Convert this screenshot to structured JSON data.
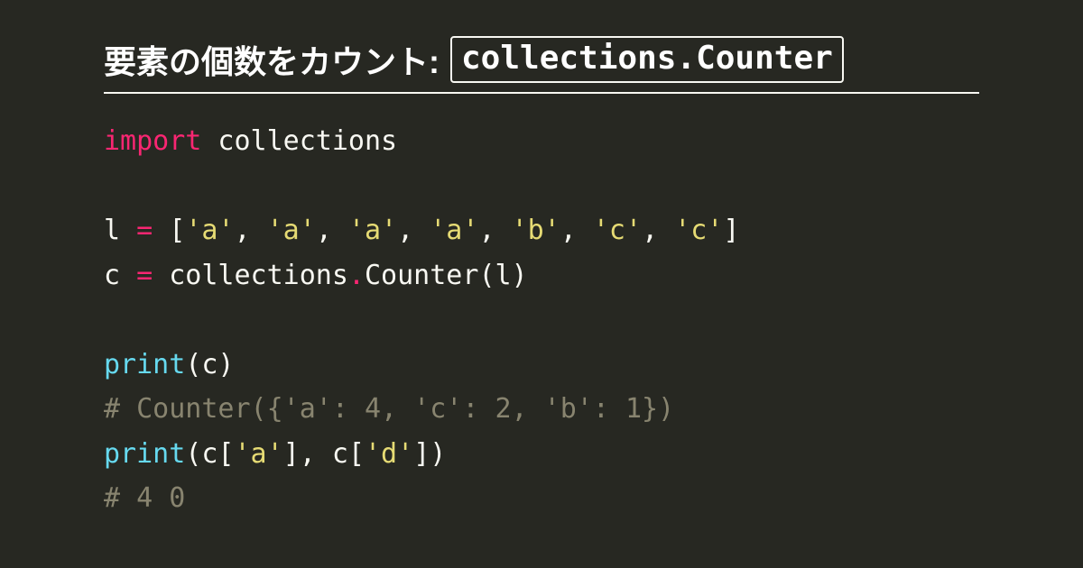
{
  "header": {
    "title_text": "要素の個数をカウント:",
    "title_code": "collections.Counter"
  },
  "code": {
    "lines": [
      [
        {
          "cls": "tok-kw",
          "t": "import"
        },
        {
          "cls": "tok-def",
          "t": " collections"
        }
      ],
      [],
      [
        {
          "cls": "tok-def",
          "t": "l "
        },
        {
          "cls": "tok-op",
          "t": "="
        },
        {
          "cls": "tok-def",
          "t": " "
        },
        {
          "cls": "tok-punc",
          "t": "["
        },
        {
          "cls": "tok-str",
          "t": "'a'"
        },
        {
          "cls": "tok-punc",
          "t": ", "
        },
        {
          "cls": "tok-str",
          "t": "'a'"
        },
        {
          "cls": "tok-punc",
          "t": ", "
        },
        {
          "cls": "tok-str",
          "t": "'a'"
        },
        {
          "cls": "tok-punc",
          "t": ", "
        },
        {
          "cls": "tok-str",
          "t": "'a'"
        },
        {
          "cls": "tok-punc",
          "t": ", "
        },
        {
          "cls": "tok-str",
          "t": "'b'"
        },
        {
          "cls": "tok-punc",
          "t": ", "
        },
        {
          "cls": "tok-str",
          "t": "'c'"
        },
        {
          "cls": "tok-punc",
          "t": ", "
        },
        {
          "cls": "tok-str",
          "t": "'c'"
        },
        {
          "cls": "tok-punc",
          "t": "]"
        }
      ],
      [
        {
          "cls": "tok-def",
          "t": "c "
        },
        {
          "cls": "tok-op",
          "t": "="
        },
        {
          "cls": "tok-def",
          "t": " collections"
        },
        {
          "cls": "tok-op",
          "t": "."
        },
        {
          "cls": "tok-def",
          "t": "Counter"
        },
        {
          "cls": "tok-punc",
          "t": "(l)"
        }
      ],
      [],
      [
        {
          "cls": "tok-fn",
          "t": "print"
        },
        {
          "cls": "tok-punc",
          "t": "(c)"
        }
      ],
      [
        {
          "cls": "tok-cm",
          "t": "# Counter({'a': 4, 'c': 2, 'b': 1})"
        }
      ],
      [
        {
          "cls": "tok-fn",
          "t": "print"
        },
        {
          "cls": "tok-punc",
          "t": "(c["
        },
        {
          "cls": "tok-str",
          "t": "'a'"
        },
        {
          "cls": "tok-punc",
          "t": "], c["
        },
        {
          "cls": "tok-str",
          "t": "'d'"
        },
        {
          "cls": "tok-punc",
          "t": "])"
        }
      ],
      [
        {
          "cls": "tok-cm",
          "t": "# 4 0"
        }
      ]
    ]
  }
}
